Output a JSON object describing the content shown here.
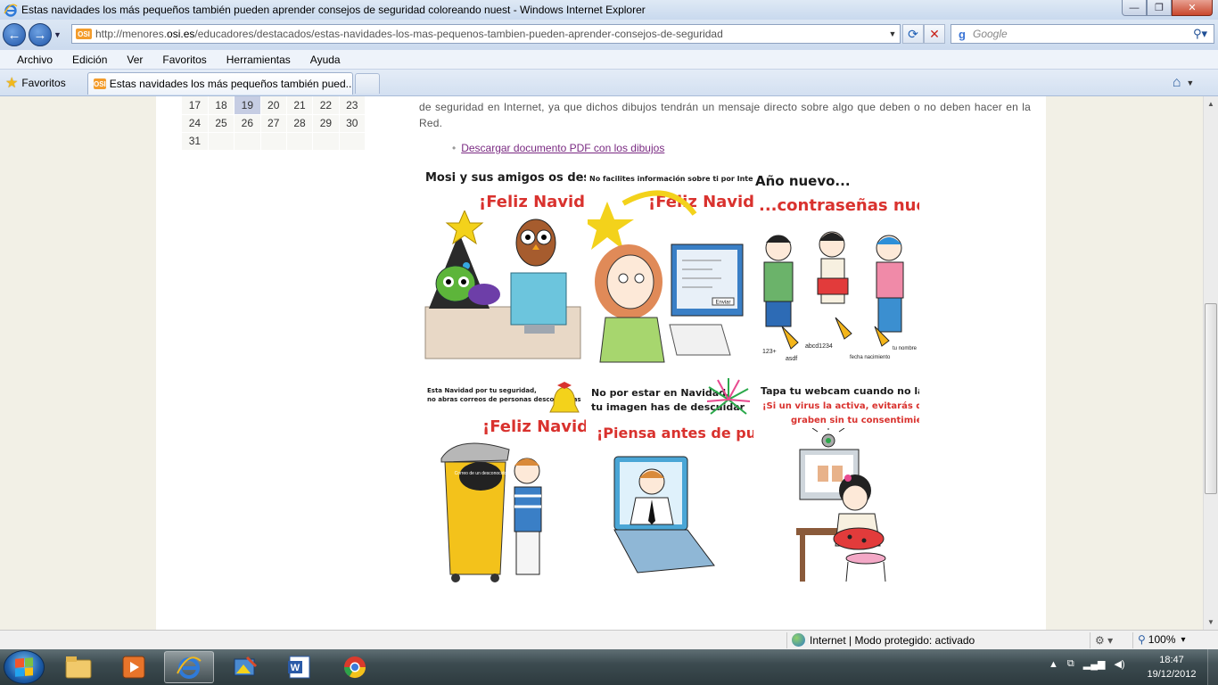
{
  "window": {
    "title": "Estas navidades los más pequeños también pueden aprender consejos de seguridad coloreando nuest - Windows Internet Explorer",
    "minimize_glyph": "—",
    "maximize_glyph": "❐",
    "close_glyph": "✕"
  },
  "address_bar": {
    "url_prefix": "http://menores.",
    "url_host": "osi.es",
    "url_path": "/educadores/destacados/estas-navidades-los-mas-pequenos-tambien-pueden-aprender-consejos-de-seguridad",
    "site_icon_text": "OSI"
  },
  "search": {
    "placeholder": "Google",
    "provider_letter": "g"
  },
  "menu": [
    "Archivo",
    "Edición",
    "Ver",
    "Favoritos",
    "Herramientas",
    "Ayuda"
  ],
  "favorites": {
    "label": "Favoritos"
  },
  "tab": {
    "title": "Estas navidades los más pequeños también pued..."
  },
  "calendar": {
    "rows": [
      [
        "17",
        "18",
        "19",
        "20",
        "21",
        "22",
        "23"
      ],
      [
        "24",
        "25",
        "26",
        "27",
        "28",
        "29",
        "30"
      ],
      [
        "31",
        "",
        "",
        "",
        "",
        "",
        ""
      ]
    ],
    "today": "19"
  },
  "content": {
    "paragraph": "de seguridad en Internet, ya que dichos dibujos tendrán un mensaje directo sobre algo que deben o no deben hacer en la Red.",
    "pdf_link": "Descargar documento PDF con los dibujos"
  },
  "panels": [
    {
      "line1": "Mosi y sus amigos os desean",
      "headline": "¡Feliz Navidad!"
    },
    {
      "line1": "No facilites información sobre ti por Internet",
      "headline": "¡Feliz Navidad!",
      "screen_label": "Enviar"
    },
    {
      "line1": "Año nuevo...",
      "headline": "...contraseñas nuevas",
      "captions": [
        "123+",
        "asdf",
        "abcd1234",
        "fecha nacimiento",
        "tu nombre"
      ]
    },
    {
      "line1": "Esta Navidad por tu seguridad,",
      "line2": "no abras correos de personas desconocidas",
      "headline": "¡Feliz Navidad!",
      "bubble": "Correo de un desconocido"
    },
    {
      "line1": "No por estar en Navidad,",
      "line2": "tu imagen has de descuidar",
      "headline": "¡Piensa antes de publicar!"
    },
    {
      "line1": "Tapa tu webcam cuando no la uses.",
      "line2": "¡Si un virus la activa, evitarás que te",
      "line3": "graben sin tu consentimiento!"
    }
  ],
  "status": {
    "zone": "Internet | Modo protegido: activado",
    "zoom": "100%",
    "zoom_arrow": "▾"
  },
  "taskbar": {
    "apps": [
      "explorer-folder",
      "media-player",
      "internet-explorer",
      "image-editor",
      "word",
      "chrome"
    ],
    "time": "18:47",
    "date": "19/12/2012"
  },
  "colors": {
    "title_bar": "#dfe9f5",
    "page_bg": "#f2f0e6",
    "accent_red": "#d9322e",
    "link": "#7a2a82",
    "today_cell": "#c6cde3"
  }
}
